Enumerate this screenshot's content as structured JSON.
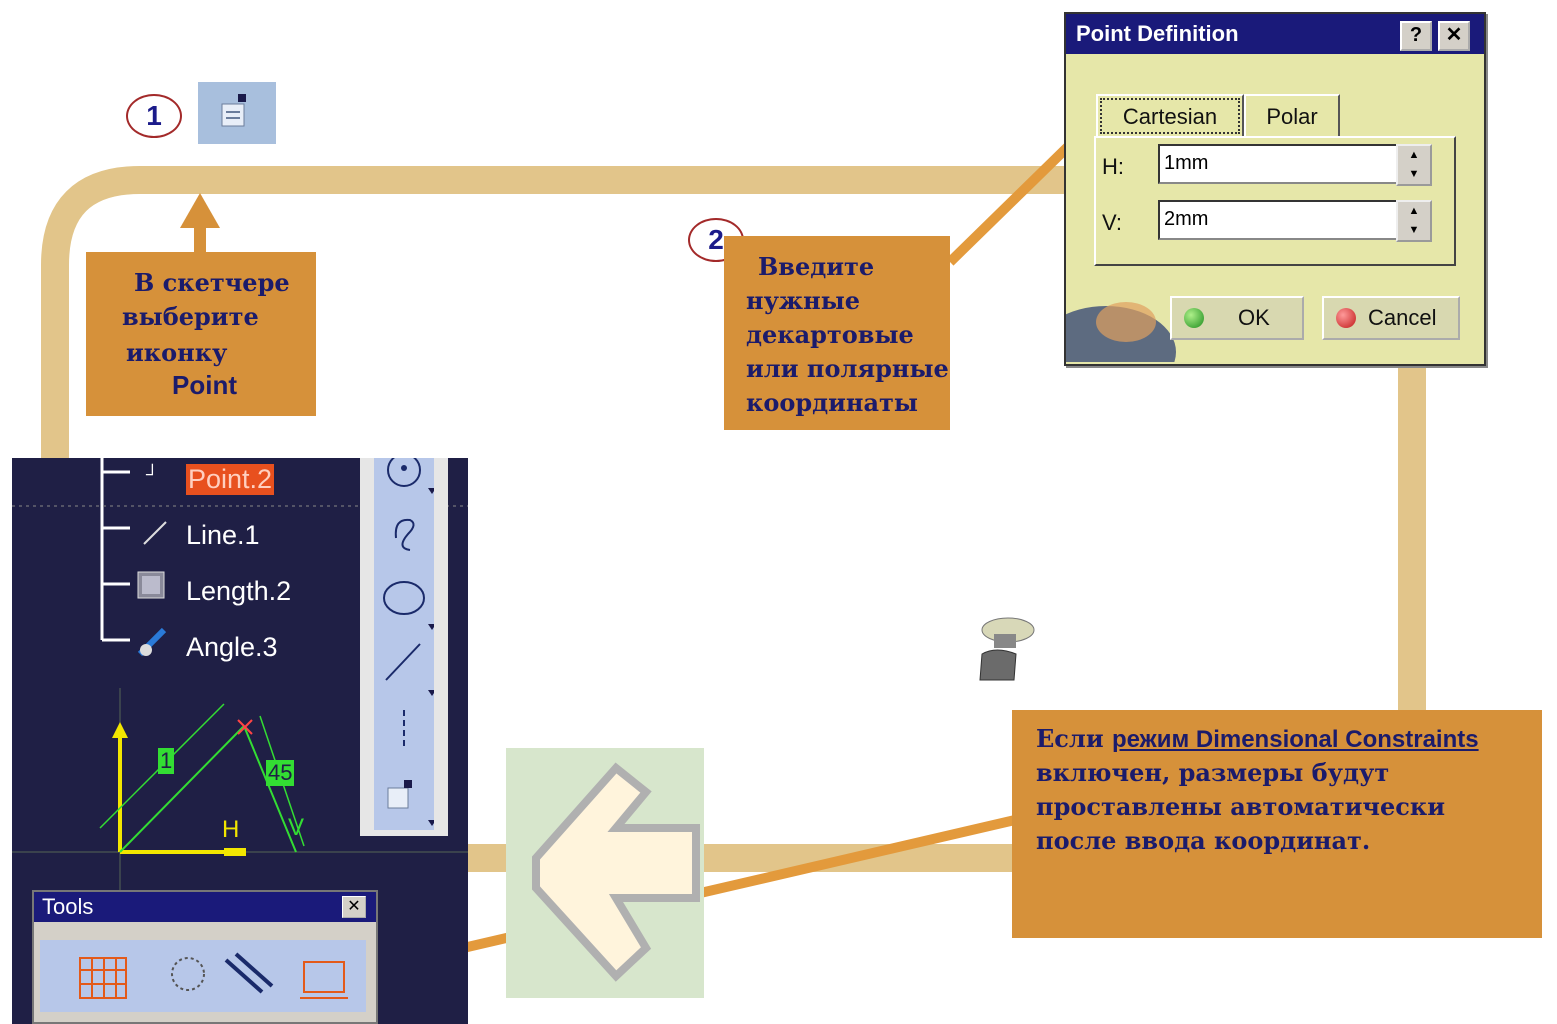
{
  "step1": {
    "number": "1"
  },
  "step2": {
    "number": "2"
  },
  "note1": {
    "line1": "В скетчере",
    "line2": "выберите",
    "line3": "иконку",
    "line4": "Point"
  },
  "note2": {
    "line1": "Введите",
    "line2": "нужные",
    "line3": "декартовые",
    "line4": "или полярные",
    "line5": "координаты"
  },
  "note3": {
    "prefix": "Если ",
    "link": "режим Dimensional Constraints",
    "line2": "включен, размеры будут",
    "line3": "проставлены автоматически",
    "line4": "после ввода координат."
  },
  "dialog": {
    "title": "Point Definition",
    "help_label": "?",
    "close_label": "✕",
    "tabs": [
      {
        "label": "Cartesian"
      },
      {
        "label": "Polar"
      }
    ],
    "h_label": "H:",
    "h_value": "1mm",
    "v_label": "V:",
    "v_value": "2mm",
    "ok_label": "OK",
    "cancel_label": "Cancel"
  },
  "tree": {
    "items": [
      {
        "label": "Point.2"
      },
      {
        "label": "Line.1"
      },
      {
        "label": "Length.2"
      },
      {
        "label": "Angle.3"
      }
    ]
  },
  "sketch": {
    "dim1": "1",
    "dim2": "45",
    "axis_h": "H",
    "axis_v": "V"
  },
  "tools": {
    "title": "Tools",
    "close_label": "✕"
  },
  "colors": {
    "note_bg": "#d6913a",
    "connector": "#e2c58a",
    "cad_bg": "#1f1f45",
    "sketch_green": "#33dd33",
    "dialog_bg": "#e6e7a9"
  }
}
